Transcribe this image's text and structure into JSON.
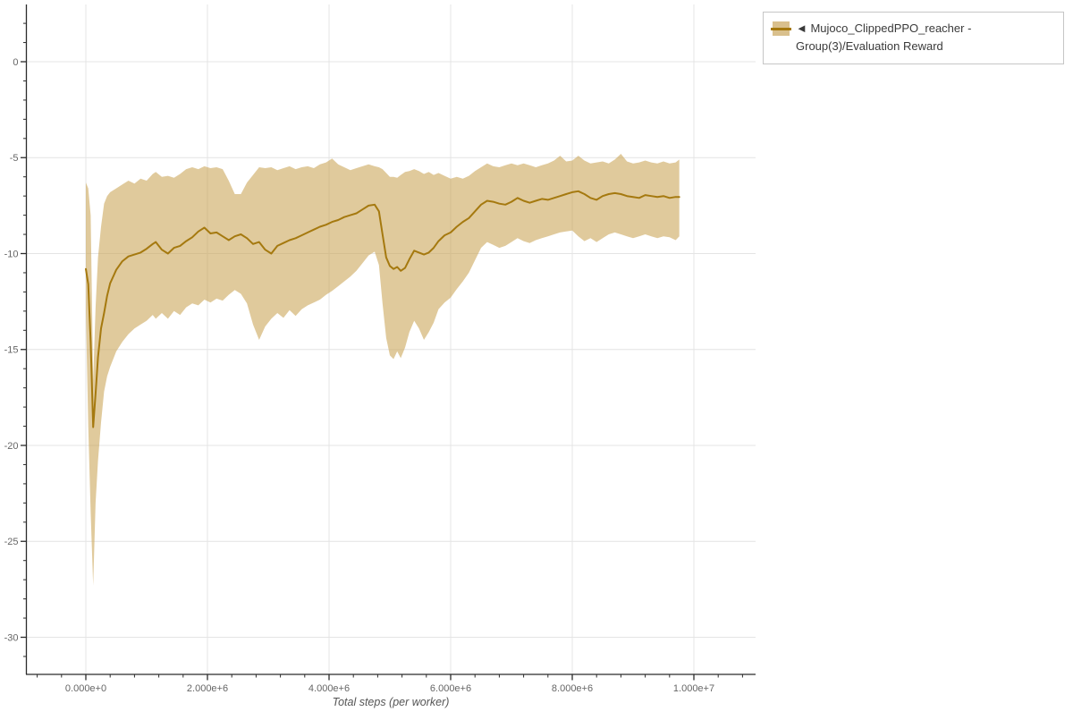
{
  "page": {
    "background": "#ffffff"
  },
  "legend": {
    "entries": [
      {
        "marker": "band-with-line",
        "label": "◄ Mujoco_ClippedPPO_reacher - Group(3)/Evaluation Reward",
        "line_color": "#a5790f",
        "band_color": "#d9c08d"
      }
    ]
  },
  "chart_data": {
    "type": "line",
    "title": "",
    "xlabel": "Total steps (per worker)",
    "ylabel": "",
    "x_units_multiplier": 1000000,
    "xlim_e6": [
      -1.0,
      11.0
    ],
    "ylim": [
      -31.9,
      3.0
    ],
    "grid": true,
    "legend_position": "top-right-outside",
    "x_tick_values_e6": [
      0,
      2,
      4,
      6,
      8,
      10
    ],
    "x_tick_labels": [
      "0.000e+0",
      "2.000e+6",
      "4.000e+6",
      "6.000e+6",
      "8.000e+6",
      "1.000e+7"
    ],
    "y_tick_values": [
      0,
      -5,
      -10,
      -15,
      -20,
      -25,
      -30
    ],
    "y_tick_labels": [
      "0",
      "-5",
      "-10",
      "-15",
      "-20",
      "-25",
      "-30"
    ],
    "series": [
      {
        "name": "Mujoco_ClippedPPO_reacher - Group(3)/Evaluation Reward",
        "line_color": "#a5790f",
        "band_fill": "rgba(203,167,90,0.6)",
        "x_e6": [
          0,
          0.04,
          0.08,
          0.12,
          0.16,
          0.2,
          0.25,
          0.3,
          0.35,
          0.4,
          0.5,
          0.6,
          0.7,
          0.8,
          0.9,
          1.0,
          1.1,
          1.15,
          1.25,
          1.35,
          1.45,
          1.55,
          1.65,
          1.75,
          1.85,
          1.95,
          2.05,
          2.15,
          2.25,
          2.35,
          2.45,
          2.55,
          2.65,
          2.75,
          2.85,
          2.95,
          3.05,
          3.15,
          3.25,
          3.35,
          3.45,
          3.55,
          3.65,
          3.75,
          3.85,
          3.95,
          4.05,
          4.15,
          4.25,
          4.35,
          4.45,
          4.55,
          4.65,
          4.75,
          4.82,
          4.88,
          4.94,
          5.0,
          5.06,
          5.12,
          5.18,
          5.25,
          5.32,
          5.4,
          5.48,
          5.56,
          5.64,
          5.72,
          5.8,
          5.9,
          6.0,
          6.1,
          6.2,
          6.3,
          6.4,
          6.5,
          6.6,
          6.7,
          6.8,
          6.9,
          7.0,
          7.1,
          7.2,
          7.3,
          7.4,
          7.5,
          7.6,
          7.7,
          7.8,
          7.9,
          8.0,
          8.1,
          8.2,
          8.3,
          8.4,
          8.5,
          8.6,
          8.7,
          8.8,
          8.9,
          9.0,
          9.1,
          9.2,
          9.3,
          9.4,
          9.5,
          9.6,
          9.7,
          9.76
        ],
        "mean": [
          -10.8,
          -11.6,
          -14.6,
          -19.05,
          -17.3,
          -15.4,
          -13.9,
          -13.1,
          -12.2,
          -11.55,
          -10.85,
          -10.4,
          -10.15,
          -10.05,
          -9.95,
          -9.75,
          -9.5,
          -9.4,
          -9.8,
          -10.0,
          -9.7,
          -9.6,
          -9.35,
          -9.15,
          -8.85,
          -8.65,
          -8.95,
          -8.9,
          -9.1,
          -9.3,
          -9.1,
          -9.0,
          -9.2,
          -9.5,
          -9.4,
          -9.8,
          -10.0,
          -9.6,
          -9.45,
          -9.3,
          -9.2,
          -9.05,
          -8.9,
          -8.75,
          -8.6,
          -8.5,
          -8.35,
          -8.25,
          -8.1,
          -8.0,
          -7.9,
          -7.7,
          -7.5,
          -7.45,
          -7.8,
          -9.0,
          -10.2,
          -10.65,
          -10.8,
          -10.7,
          -10.9,
          -10.75,
          -10.3,
          -9.85,
          -9.95,
          -10.05,
          -9.95,
          -9.7,
          -9.35,
          -9.05,
          -8.9,
          -8.6,
          -8.35,
          -8.15,
          -7.8,
          -7.45,
          -7.25,
          -7.3,
          -7.4,
          -7.45,
          -7.3,
          -7.1,
          -7.25,
          -7.35,
          -7.25,
          -7.15,
          -7.2,
          -7.1,
          -7.0,
          -6.9,
          -6.8,
          -6.75,
          -6.9,
          -7.1,
          -7.2,
          -7.0,
          -6.9,
          -6.85,
          -6.9,
          -7.0,
          -7.05,
          -7.1,
          -6.95,
          -7.0,
          -7.05,
          -7.0,
          -7.1,
          -7.05,
          -7.05
        ],
        "upper": [
          -6.3,
          -6.6,
          -8.0,
          -16.6,
          -12.8,
          -10.2,
          -8.6,
          -7.4,
          -7.0,
          -6.8,
          -6.6,
          -6.4,
          -6.2,
          -6.35,
          -6.1,
          -6.2,
          -5.85,
          -5.75,
          -6.0,
          -5.95,
          -6.05,
          -5.85,
          -5.6,
          -5.5,
          -5.6,
          -5.45,
          -5.55,
          -5.5,
          -5.6,
          -6.2,
          -6.9,
          -6.9,
          -6.3,
          -5.9,
          -5.5,
          -5.55,
          -5.5,
          -5.65,
          -5.55,
          -5.45,
          -5.6,
          -5.5,
          -5.45,
          -5.55,
          -5.35,
          -5.25,
          -5.05,
          -5.35,
          -5.5,
          -5.65,
          -5.55,
          -5.45,
          -5.35,
          -5.45,
          -5.5,
          -5.6,
          -5.8,
          -6.0,
          -6.0,
          -6.05,
          -5.9,
          -5.75,
          -5.7,
          -5.6,
          -5.7,
          -5.85,
          -5.75,
          -5.9,
          -5.8,
          -5.95,
          -6.1,
          -6.0,
          -6.1,
          -5.95,
          -5.7,
          -5.5,
          -5.3,
          -5.45,
          -5.5,
          -5.4,
          -5.3,
          -5.4,
          -5.3,
          -5.4,
          -5.5,
          -5.4,
          -5.3,
          -5.15,
          -4.9,
          -5.2,
          -5.15,
          -4.9,
          -5.15,
          -5.3,
          -5.25,
          -5.2,
          -5.3,
          -5.1,
          -4.8,
          -5.2,
          -5.3,
          -5.25,
          -5.15,
          -5.25,
          -5.3,
          -5.2,
          -5.3,
          -5.25,
          -5.1
        ],
        "lower": [
          -13.0,
          -19.0,
          -23.5,
          -27.3,
          -23.0,
          -20.8,
          -18.8,
          -17.2,
          -16.4,
          -15.9,
          -15.1,
          -14.6,
          -14.2,
          -13.9,
          -13.7,
          -13.5,
          -13.2,
          -13.4,
          -13.1,
          -13.4,
          -13.0,
          -13.2,
          -12.8,
          -12.6,
          -12.7,
          -12.4,
          -12.55,
          -12.35,
          -12.45,
          -12.15,
          -11.9,
          -12.1,
          -12.6,
          -13.7,
          -14.5,
          -13.8,
          -13.4,
          -13.1,
          -13.35,
          -12.95,
          -13.25,
          -12.9,
          -12.7,
          -12.55,
          -12.4,
          -12.15,
          -11.95,
          -11.7,
          -11.45,
          -11.2,
          -10.9,
          -10.5,
          -10.1,
          -9.9,
          -10.6,
          -12.6,
          -14.4,
          -15.3,
          -15.5,
          -15.1,
          -15.45,
          -14.9,
          -14.1,
          -13.5,
          -13.9,
          -14.5,
          -14.1,
          -13.6,
          -12.9,
          -12.55,
          -12.3,
          -11.85,
          -11.45,
          -11.0,
          -10.35,
          -9.7,
          -9.4,
          -9.55,
          -9.7,
          -9.6,
          -9.4,
          -9.2,
          -9.35,
          -9.45,
          -9.3,
          -9.2,
          -9.1,
          -9.0,
          -8.9,
          -8.85,
          -8.8,
          -9.1,
          -9.35,
          -9.2,
          -9.4,
          -9.2,
          -9.0,
          -8.9,
          -9.0,
          -9.1,
          -9.2,
          -9.1,
          -9.0,
          -9.1,
          -9.2,
          -9.1,
          -9.15,
          -9.3,
          -9.1
        ]
      }
    ],
    "colors": {
      "grid": "#e4e4e4",
      "axis_line": "#2b2b2b",
      "tick_label": "#666666",
      "axis_title": "#555555"
    }
  }
}
